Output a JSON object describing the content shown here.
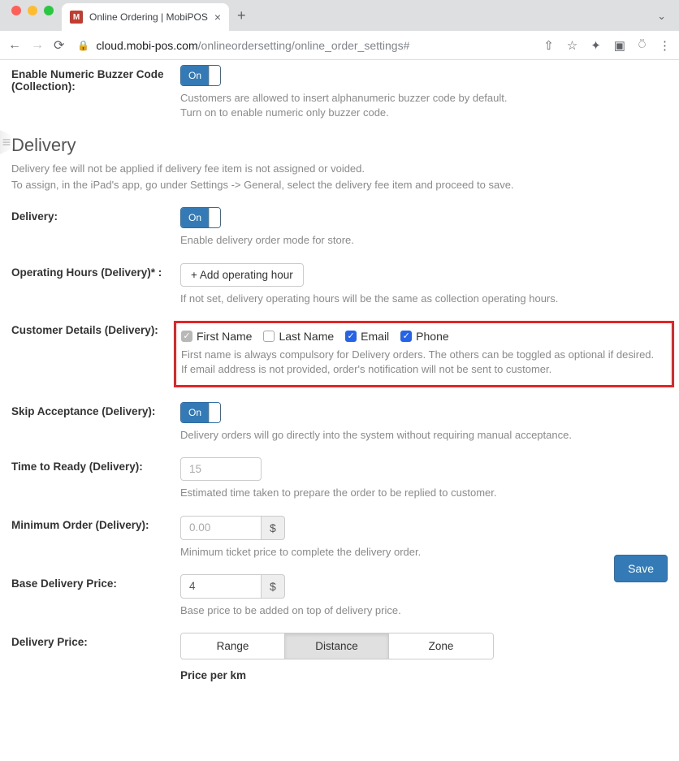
{
  "browser": {
    "tab_title": "Online Ordering | MobiPOS",
    "url_host": "cloud.mobi-pos.com",
    "url_path": "/onlineordersetting/online_order_settings#"
  },
  "buzzer": {
    "label": "Enable Numeric Buzzer Code (Collection):",
    "toggle": "On",
    "hint1": "Customers are allowed to insert alphanumeric buzzer code by default.",
    "hint2": "Turn on to enable numeric only buzzer code."
  },
  "delivery_section": {
    "title": "Delivery",
    "desc1": "Delivery fee will not be applied if delivery fee item is not assigned or voided.",
    "desc2": "To assign, in the iPad's app, go under Settings -> General, select the delivery fee item and proceed to save."
  },
  "delivery": {
    "label": "Delivery:",
    "toggle": "On",
    "hint": "Enable delivery order mode for store."
  },
  "op_hours": {
    "label": "Operating Hours (Delivery)* :",
    "button": "+ Add operating hour",
    "hint": "If not set, delivery operating hours will be the same as collection operating hours."
  },
  "cust_details": {
    "label": "Customer Details (Delivery):",
    "c1": "First Name",
    "c2": "Last Name",
    "c3": "Email",
    "c4": "Phone",
    "hint1": "First name is always compulsory for Delivery orders. The others can be toggled as optional if desired.",
    "hint2": "If email address is not provided, order's notification will not be sent to customer."
  },
  "skip": {
    "label": "Skip Acceptance (Delivery):",
    "toggle": "On",
    "hint": "Delivery orders will go directly into the system without requiring manual acceptance."
  },
  "ttr": {
    "label": "Time to Ready (Delivery):",
    "placeholder": "15",
    "hint": "Estimated time taken to prepare the order to be replied to customer."
  },
  "min_order": {
    "label": "Minimum Order (Delivery):",
    "placeholder": "0.00",
    "addon": "$",
    "hint": "Minimum ticket price to complete the delivery order."
  },
  "base_price": {
    "label": "Base Delivery Price:",
    "value": "4",
    "addon": "$",
    "hint": "Base price to be added on top of delivery price."
  },
  "dprice": {
    "label": "Delivery Price:",
    "opt1": "Range",
    "opt2": "Distance",
    "opt3": "Zone",
    "cutoff": "Price per km"
  },
  "save": "Save"
}
